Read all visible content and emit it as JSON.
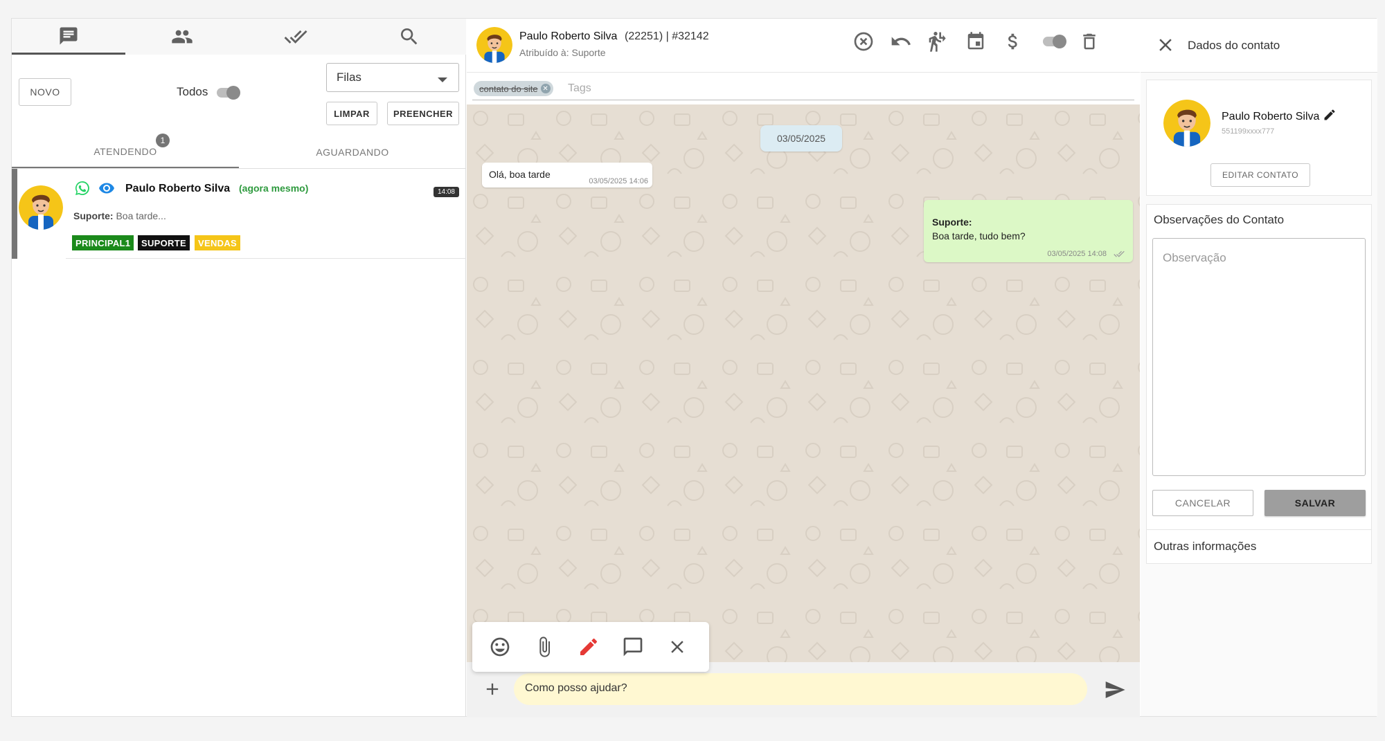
{
  "left_panel": {
    "tabs": [
      {
        "icon": "chat-icon"
      },
      {
        "icon": "group-icon"
      },
      {
        "icon": "done-all-icon"
      },
      {
        "icon": "search-icon"
      }
    ],
    "novo_label": "NOVO",
    "todos_label": "Todos",
    "filas_value": "Filas",
    "limpar_label": "LIMPAR",
    "preencher_label": "PREENCHER",
    "subtabs": [
      {
        "label": "ATENDENDO",
        "badge": "1"
      },
      {
        "label": "AGUARDANDO"
      }
    ],
    "ticket": {
      "name": "Paulo Roberto Silva",
      "when": "(agora mesmo)",
      "time": "14:08",
      "preview_sender": "Suporte:",
      "preview_text": "Boa tarde...",
      "tags": [
        {
          "label": "PRINCIPAL1",
          "color": "#1b8a1b"
        },
        {
          "label": "SUPORTE",
          "color": "#111111"
        },
        {
          "label": "VENDAS",
          "color": "#f5c518"
        }
      ]
    }
  },
  "chat": {
    "contact_name": "Paulo Roberto Silva",
    "contact_ids": "(22251) | #32142",
    "assigned": "Atribuído à: Suporte",
    "header_icons": [
      "close-circle-icon",
      "undo-icon",
      "transfer-icon",
      "calendar-icon",
      "dollar-icon",
      "toggle-icon",
      "trash-icon"
    ],
    "tag_chip": "contato do site",
    "tags_placeholder": "Tags",
    "date_separator": "03/05/2025",
    "messages": [
      {
        "direction": "in",
        "text": "Olá, boa tarde",
        "time": "03/05/2025 14:06"
      },
      {
        "direction": "out",
        "sender": "Suporte:",
        "text": "Boa tarde, tudo bem?",
        "time": "03/05/2025 14:08"
      }
    ],
    "toolbox_icons": [
      "emoji-icon",
      "paperclip-icon",
      "pencil-icon",
      "message-icon",
      "close-icon"
    ],
    "composer_value": "Como posso ajudar?"
  },
  "contact_panel": {
    "title": "Dados do contato",
    "name": "Paulo Roberto Silva",
    "number": "551199xxxx777",
    "edit_label": "EDITAR CONTATO",
    "obs_title": "Observações do Contato",
    "obs_placeholder": "Observação",
    "cancel_label": "CANCELAR",
    "save_label": "SALVAR",
    "other_info": "Outras informações"
  },
  "colors": {
    "whatsapp": "#25d366",
    "eye": "#1e88e5",
    "now_text": "#2e9a3e",
    "out_bubble": "#dcf8c6",
    "wallpaper": "#e6ded3",
    "pencil_active": "#e53935"
  }
}
